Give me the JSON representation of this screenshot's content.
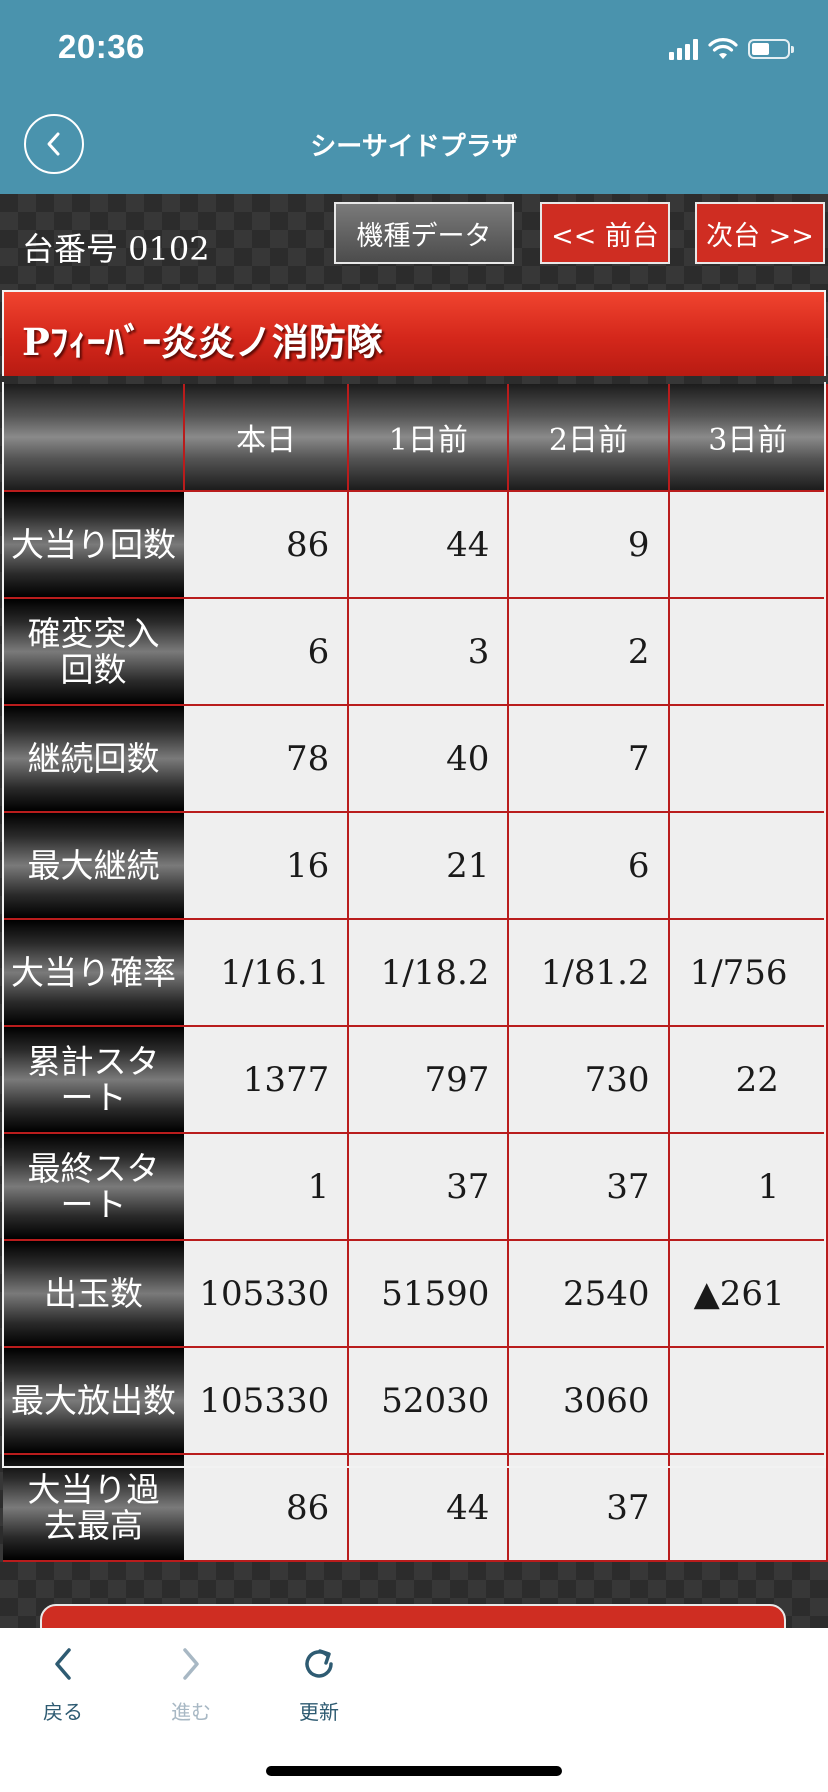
{
  "status_bar": {
    "time": "20:36",
    "battery_level": 0.5
  },
  "nav": {
    "title": "シーサイドプラザ"
  },
  "header": {
    "machine_number": "台番号 0102",
    "model_data_button": "機種データ",
    "prev_button": "<< 前台",
    "next_button": "次台 >>"
  },
  "machine_title": "Pﾌｨｰﾊﾞｰ炎炎ノ消防隊",
  "table": {
    "columns": [
      "本日",
      "1日前",
      "2日前",
      "3日前"
    ],
    "rows": [
      {
        "label": "大当り回数",
        "values": [
          "86",
          "44",
          "9",
          ""
        ]
      },
      {
        "label": "確変突入回数",
        "values": [
          "6",
          "3",
          "2",
          ""
        ]
      },
      {
        "label": "継続回数",
        "values": [
          "78",
          "40",
          "7",
          ""
        ]
      },
      {
        "label": "最大継続",
        "values": [
          "16",
          "21",
          "6",
          ""
        ]
      },
      {
        "label": "大当り確率",
        "values": [
          "1/16.1",
          "1/18.2",
          "1/81.2",
          "1/756"
        ]
      },
      {
        "label": "累計スタート",
        "values": [
          "1377",
          "797",
          "730",
          "22"
        ]
      },
      {
        "label": "最終スタート",
        "values": [
          "1",
          "37",
          "37",
          "1"
        ]
      },
      {
        "label": "出玉数",
        "values": [
          "105330",
          "51590",
          "2540",
          "▲261"
        ]
      },
      {
        "label": "最大放出数",
        "values": [
          "105330",
          "52030",
          "3060",
          ""
        ]
      },
      {
        "label": "大当り過去最高",
        "values": [
          "86",
          "44",
          "37",
          ""
        ]
      }
    ]
  },
  "toolbar": {
    "back_label": "戻る",
    "forward_label": "進む",
    "reload_label": "更新"
  }
}
